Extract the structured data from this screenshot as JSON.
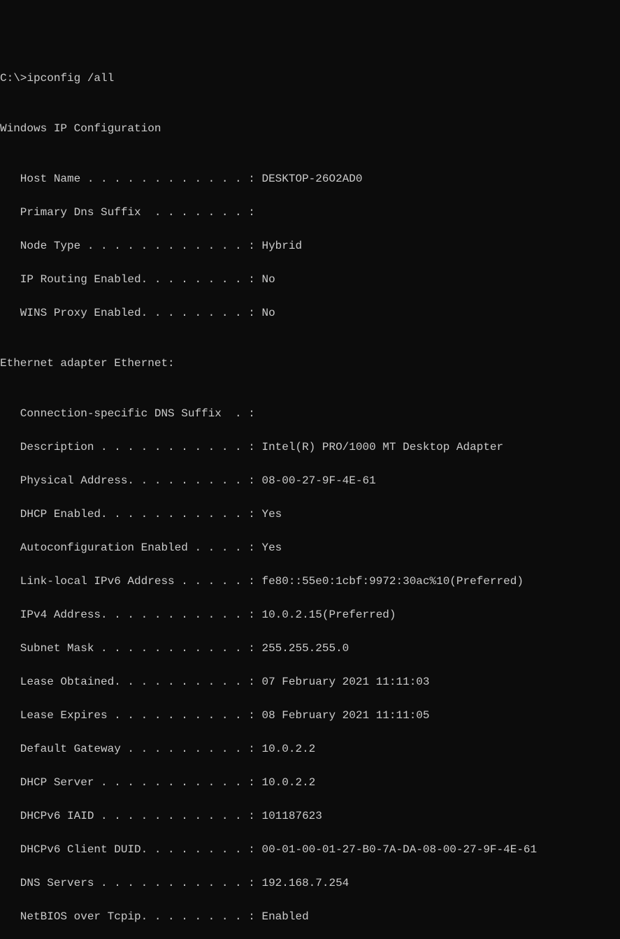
{
  "prompt": "C:\\>ipconfig /all",
  "blank": "",
  "header": "Windows IP Configuration",
  "ipconfig": {
    "host_name": "   Host Name . . . . . . . . . . . . : DESKTOP-26O2AD0",
    "primary_dns": "   Primary Dns Suffix  . . . . . . . :",
    "node_type": "   Node Type . . . . . . . . . . . . : Hybrid",
    "ip_routing": "   IP Routing Enabled. . . . . . . . : No",
    "wins_proxy": "   WINS Proxy Enabled. . . . . . . . : No"
  },
  "adapter_header": "Ethernet adapter Ethernet:",
  "adapter": {
    "conn_suffix": "   Connection-specific DNS Suffix  . :",
    "description": "   Description . . . . . . . . . . . : Intel(R) PRO/1000 MT Desktop Adapter",
    "physical_addr": "   Physical Address. . . . . . . . . : 08-00-27-9F-4E-61",
    "dhcp_enabled": "   DHCP Enabled. . . . . . . . . . . : Yes",
    "autoconfig": "   Autoconfiguration Enabled . . . . : Yes",
    "link_local": "   Link-local IPv6 Address . . . . . : fe80::55e0:1cbf:9972:30ac%10(Preferred)",
    "ipv4": "   IPv4 Address. . . . . . . . . . . : 10.0.2.15(Preferred)",
    "subnet": "   Subnet Mask . . . . . . . . . . . : 255.255.255.0",
    "lease_obtained": "   Lease Obtained. . . . . . . . . . : 07 February 2021 11:11:03",
    "lease_expires": "   Lease Expires . . . . . . . . . . : 08 February 2021 11:11:05",
    "gateway": "   Default Gateway . . . . . . . . . : 10.0.2.2",
    "dhcp_server": "   DHCP Server . . . . . . . . . . . : 10.0.2.2",
    "dhcpv6_iaid": "   DHCPv6 IAID . . . . . . . . . . . : 101187623",
    "dhcpv6_duid": "   DHCPv6 Client DUID. . . . . . . . : 00-01-00-01-27-B0-7A-DA-08-00-27-9F-4E-61",
    "dns_servers": "   DNS Servers . . . . . . . . . . . : 192.168.7.254",
    "netbios": "   NetBIOS over Tcpip. . . . . . . . : Enabled"
  }
}
